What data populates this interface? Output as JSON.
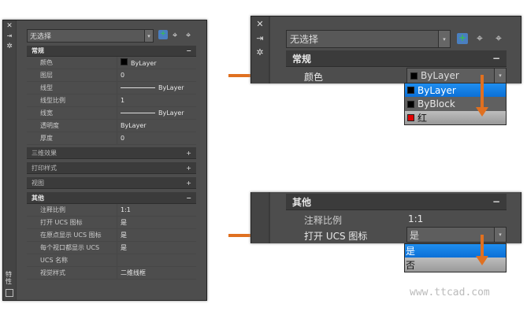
{
  "left_panel": {
    "side_icons": {
      "close": "✕",
      "autohide": "⇥",
      "settings": "✲"
    },
    "vertical_tab": "特性",
    "combo": "无选择",
    "sections": [
      {
        "title": "常规",
        "toggle": "−",
        "rows": [
          {
            "label": "颜色",
            "value": "ByLayer"
          },
          {
            "label": "图层",
            "value": "0"
          },
          {
            "label": "线型",
            "value": "ByLayer"
          },
          {
            "label": "线型比例",
            "value": "1"
          },
          {
            "label": "线宽",
            "value": "ByLayer"
          },
          {
            "label": "透明度",
            "value": "ByLayer"
          },
          {
            "label": "厚度",
            "value": "0"
          }
        ]
      },
      {
        "title": "三维效果",
        "toggle": "+"
      },
      {
        "title": "打印样式",
        "toggle": "+"
      },
      {
        "title": "视图",
        "toggle": "+"
      },
      {
        "title": "其他",
        "toggle": "−",
        "rows": [
          {
            "label": "注释比例",
            "value": "1:1"
          },
          {
            "label": "打开 UCS 图标",
            "value": "是"
          },
          {
            "label": "在原点显示 UCS 图标",
            "value": "是"
          },
          {
            "label": "每个视口都显示 UCS",
            "value": "是"
          },
          {
            "label": "UCS 名称",
            "value": ""
          },
          {
            "label": "视觉样式",
            "value": "二维线框"
          }
        ]
      }
    ]
  },
  "top_right": {
    "combo": "无选择",
    "section": "常规",
    "toggle": "−",
    "row_label": "颜色",
    "row_value": "ByLayer",
    "options": [
      {
        "label": "ByLayer",
        "color": "#000000"
      },
      {
        "label": "ByBlock",
        "color": "#000000"
      },
      {
        "label": "红",
        "color": "#e00000"
      }
    ]
  },
  "bottom_right": {
    "section": "其他",
    "toggle": "−",
    "rows": [
      {
        "label": "注释比例",
        "value": "1:1"
      },
      {
        "label": "打开 UCS 图标",
        "value": "是"
      }
    ],
    "options": [
      "是",
      "否"
    ]
  },
  "colors": {
    "arrow": "#e07020",
    "selected": "#1f8ff0"
  },
  "watermark": "www.ttcad.com"
}
